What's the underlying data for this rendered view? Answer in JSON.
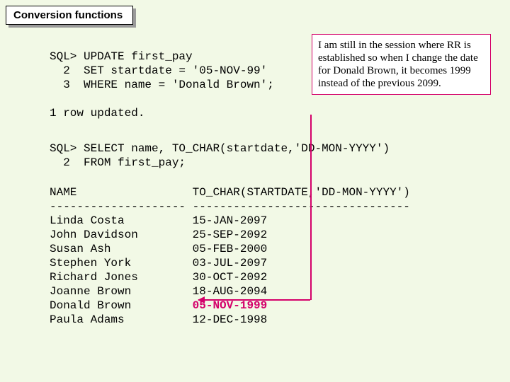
{
  "title": "Conversion functions",
  "sql_update": "SQL> UPDATE first_pay\n  2  SET startdate = '05-NOV-99'\n  3  WHERE name = 'Donald Brown';\n\n1 row updated.",
  "sql_select": "SQL> SELECT name, TO_CHAR(startdate,'DD-MON-YYYY')\n  2  FROM first_pay;",
  "callout_text": "I am still in the session where RR is established so when I change the date for Donald Brown, it becomes 1999 instead of the previous 2099.",
  "columns": {
    "header_name": "NAME",
    "header_date": "TO_CHAR(STARTDATE,'DD-MON-YYYY')",
    "sep_name": "--------------------",
    "sep_date": "--------------------------------",
    "rows": [
      {
        "name": "Linda Costa",
        "date": "15-JAN-2097",
        "hl": false
      },
      {
        "name": "John Davidson",
        "date": "25-SEP-2092",
        "hl": false
      },
      {
        "name": "Susan Ash",
        "date": "05-FEB-2000",
        "hl": false
      },
      {
        "name": "Stephen York",
        "date": "03-JUL-2097",
        "hl": false
      },
      {
        "name": "Richard Jones",
        "date": "30-OCT-2092",
        "hl": false
      },
      {
        "name": "Joanne Brown",
        "date": "18-AUG-2094",
        "hl": false
      },
      {
        "name": "Donald Brown",
        "date": "05-NOV-1999",
        "hl": true
      },
      {
        "name": "Paula Adams",
        "date": "12-DEC-1998",
        "hl": false
      }
    ]
  }
}
